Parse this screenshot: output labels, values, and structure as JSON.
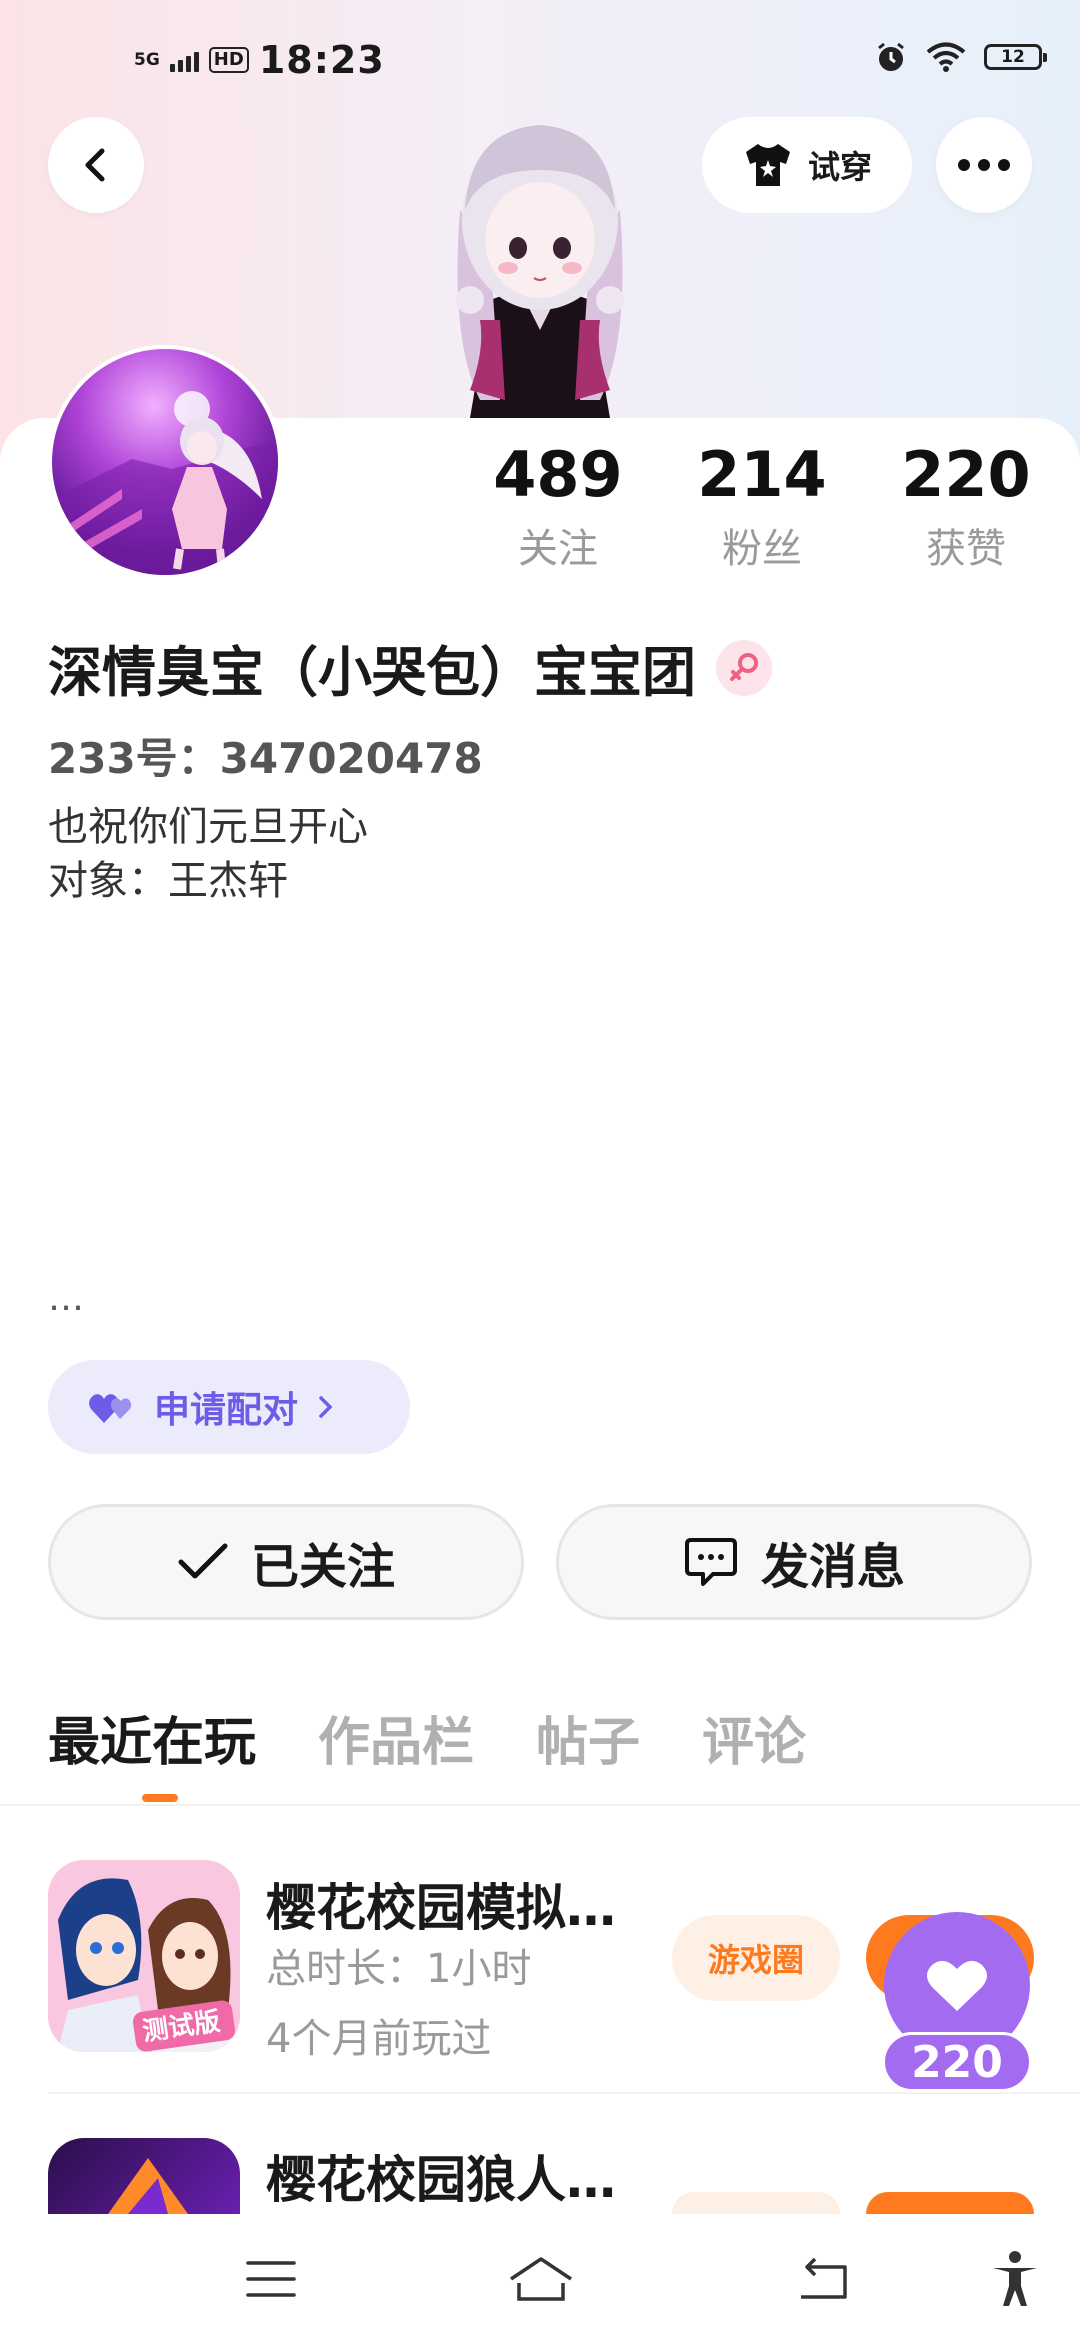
{
  "status_bar": {
    "signal": "5G",
    "hd": "HD",
    "time": "18:23",
    "battery": "12"
  },
  "header": {
    "try_on_label": "试穿"
  },
  "stats": [
    {
      "value": "489",
      "label": "关注"
    },
    {
      "value": "214",
      "label": "粉丝"
    },
    {
      "value": "220",
      "label": "获赞"
    }
  ],
  "profile": {
    "nickname": "深情臭宝（小哭包）宝宝团",
    "id_line": "233号：347020478",
    "bio": "也祝你们元旦开心\n对象：王杰轩",
    "more": "…"
  },
  "match_button": {
    "label": "申请配对"
  },
  "actions": {
    "following_label": "已关注",
    "message_label": "发消息"
  },
  "tabs": [
    "最近在玩",
    "作品栏",
    "帖子",
    "评论"
  ],
  "games": [
    {
      "title": "樱花校园模拟…",
      "duration": "总时长：1小时",
      "last_played": "4个月前玩过",
      "circle_label": "游戏圈",
      "icon_badge": "测试版"
    },
    {
      "title": "樱花校园狼人…"
    }
  ],
  "like_float": {
    "count": "220"
  },
  "colors": {
    "accent_orange": "#ff7a1f",
    "accent_purple": "#a36bf0",
    "match_purple": "#6c5ce7"
  }
}
